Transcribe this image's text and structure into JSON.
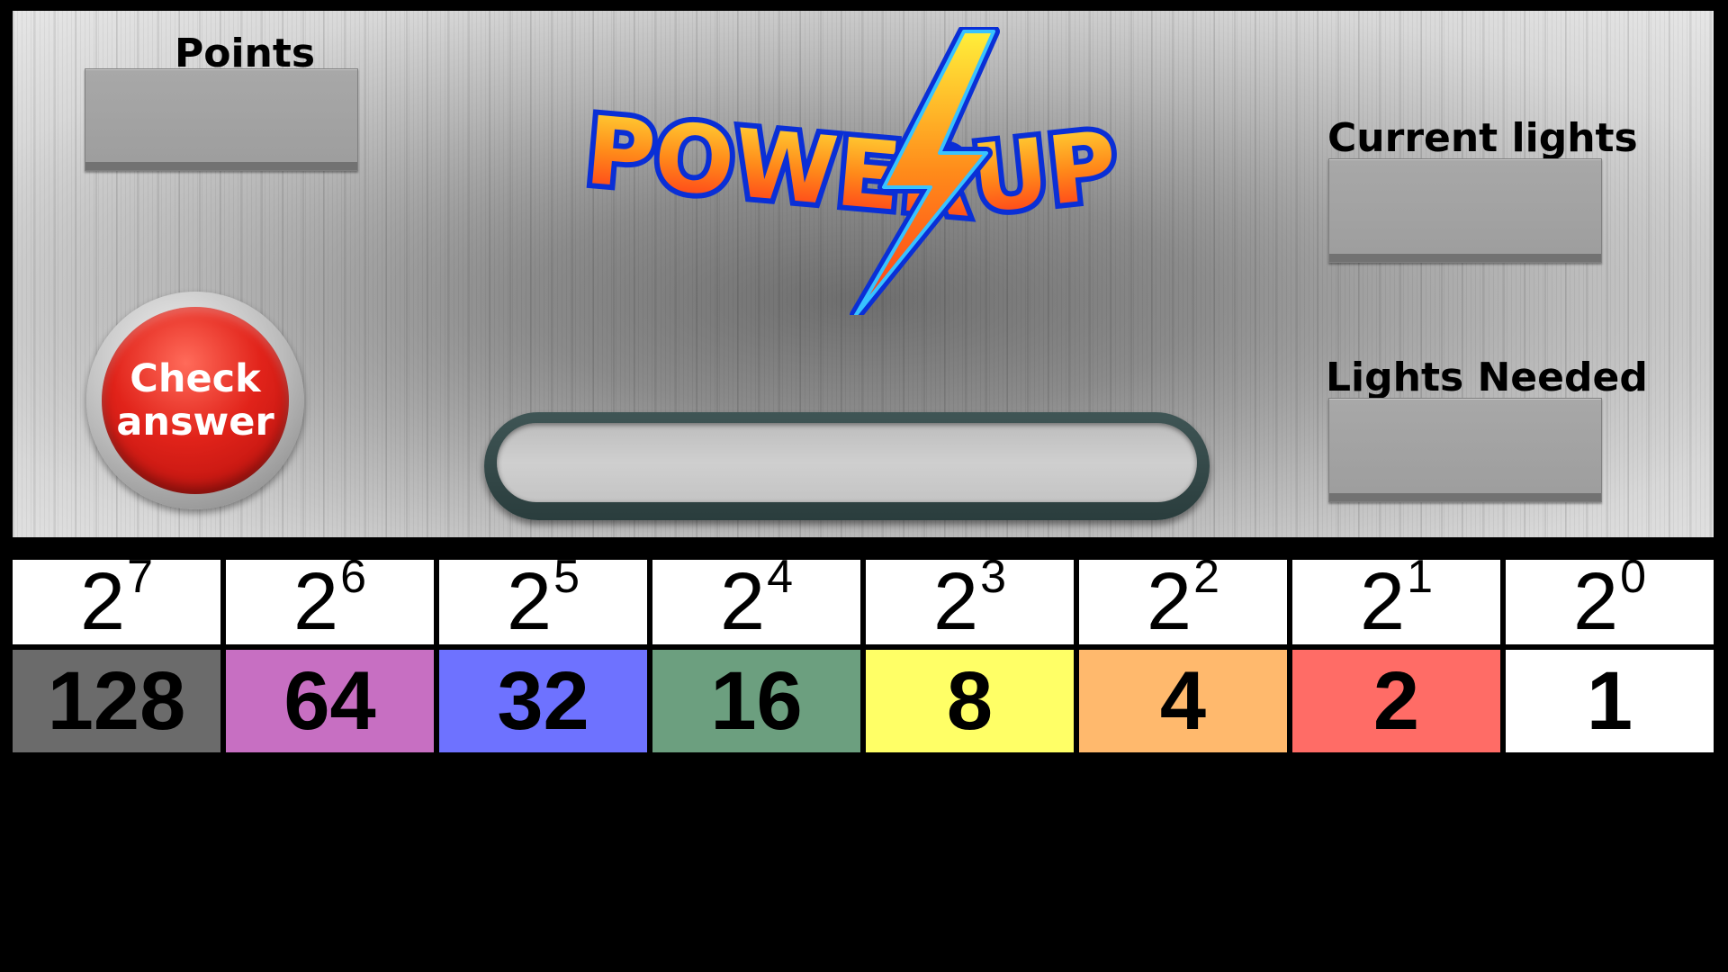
{
  "panel": {
    "points_label": "Points",
    "points_value": "",
    "current_lights_label": "Current lights",
    "current_lights_value": "",
    "lights_needed_label": "Lights Needed",
    "lights_needed_value": "",
    "check_button_line1": "Check",
    "check_button_line2": "answer",
    "answer_slot_value": ""
  },
  "logo": {
    "text_left": "POWER",
    "text_right": "UP",
    "icon": "lightning-bolt-icon"
  },
  "binary_table": {
    "columns": [
      {
        "base": "2",
        "exponent": "7",
        "value": "128",
        "color": "#6b6b6b"
      },
      {
        "base": "2",
        "exponent": "6",
        "value": "64",
        "color": "#c76fc2"
      },
      {
        "base": "2",
        "exponent": "5",
        "value": "32",
        "color": "#6e72ff"
      },
      {
        "base": "2",
        "exponent": "4",
        "value": "16",
        "color": "#6c9f7f"
      },
      {
        "base": "2",
        "exponent": "3",
        "value": "8",
        "color": "#ffff66"
      },
      {
        "base": "2",
        "exponent": "2",
        "value": "4",
        "color": "#ffb96d"
      },
      {
        "base": "2",
        "exponent": "1",
        "value": "2",
        "color": "#ff6c66"
      },
      {
        "base": "2",
        "exponent": "0",
        "value": "1",
        "color": "#ffffff"
      }
    ]
  },
  "colors": {
    "background": "#000000",
    "button_red": "#e1231a",
    "slot_border": "#3f5555",
    "display_box": "#a3a3a3"
  }
}
